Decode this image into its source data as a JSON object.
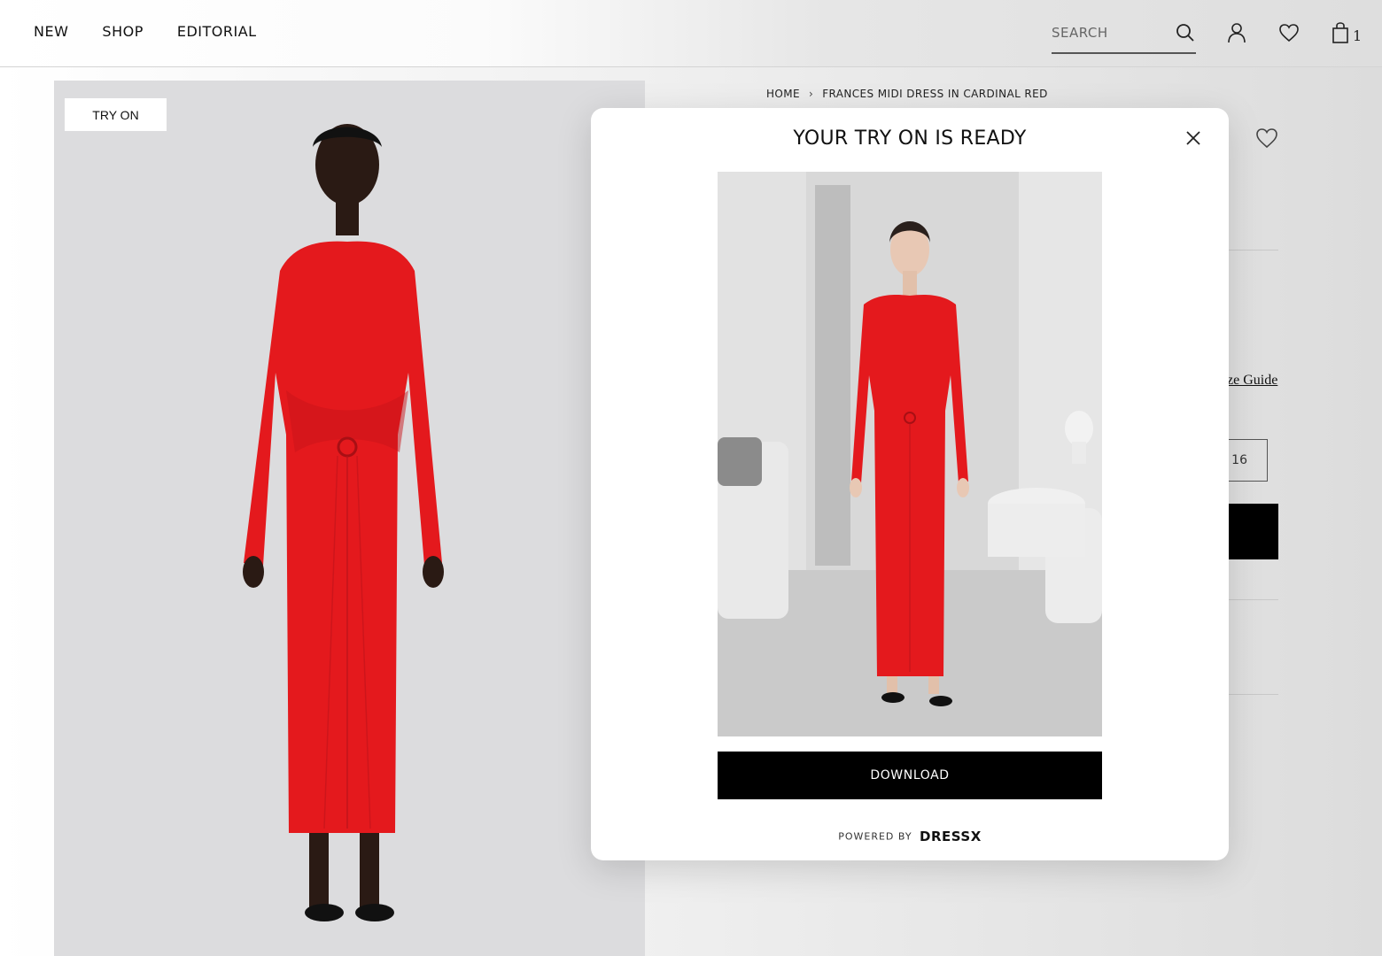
{
  "header": {
    "nav": [
      "NEW",
      "SHOP",
      "EDITORIAL"
    ],
    "search_placeholder": "SEARCH",
    "bag_count": "1"
  },
  "product": {
    "try_on_label": "TRY ON"
  },
  "breadcrumb": {
    "home": "HOME",
    "separator": "›",
    "current": "FRANCES MIDI DRESS IN CARDINAL RED"
  },
  "info": {
    "size_guide": "ze Guide",
    "size_visible": "16"
  },
  "modal": {
    "title": "YOUR TRY ON IS READY",
    "download_label": "DOWNLOAD",
    "powered_by": "POWERED BY",
    "brand": "DRESSX"
  },
  "colors": {
    "dress_red": "#e4191d",
    "button_black": "#000000",
    "product_bg": "#dcdcde"
  },
  "icons": [
    "search-icon",
    "user-icon",
    "heart-icon",
    "bag-icon",
    "close-icon"
  ]
}
